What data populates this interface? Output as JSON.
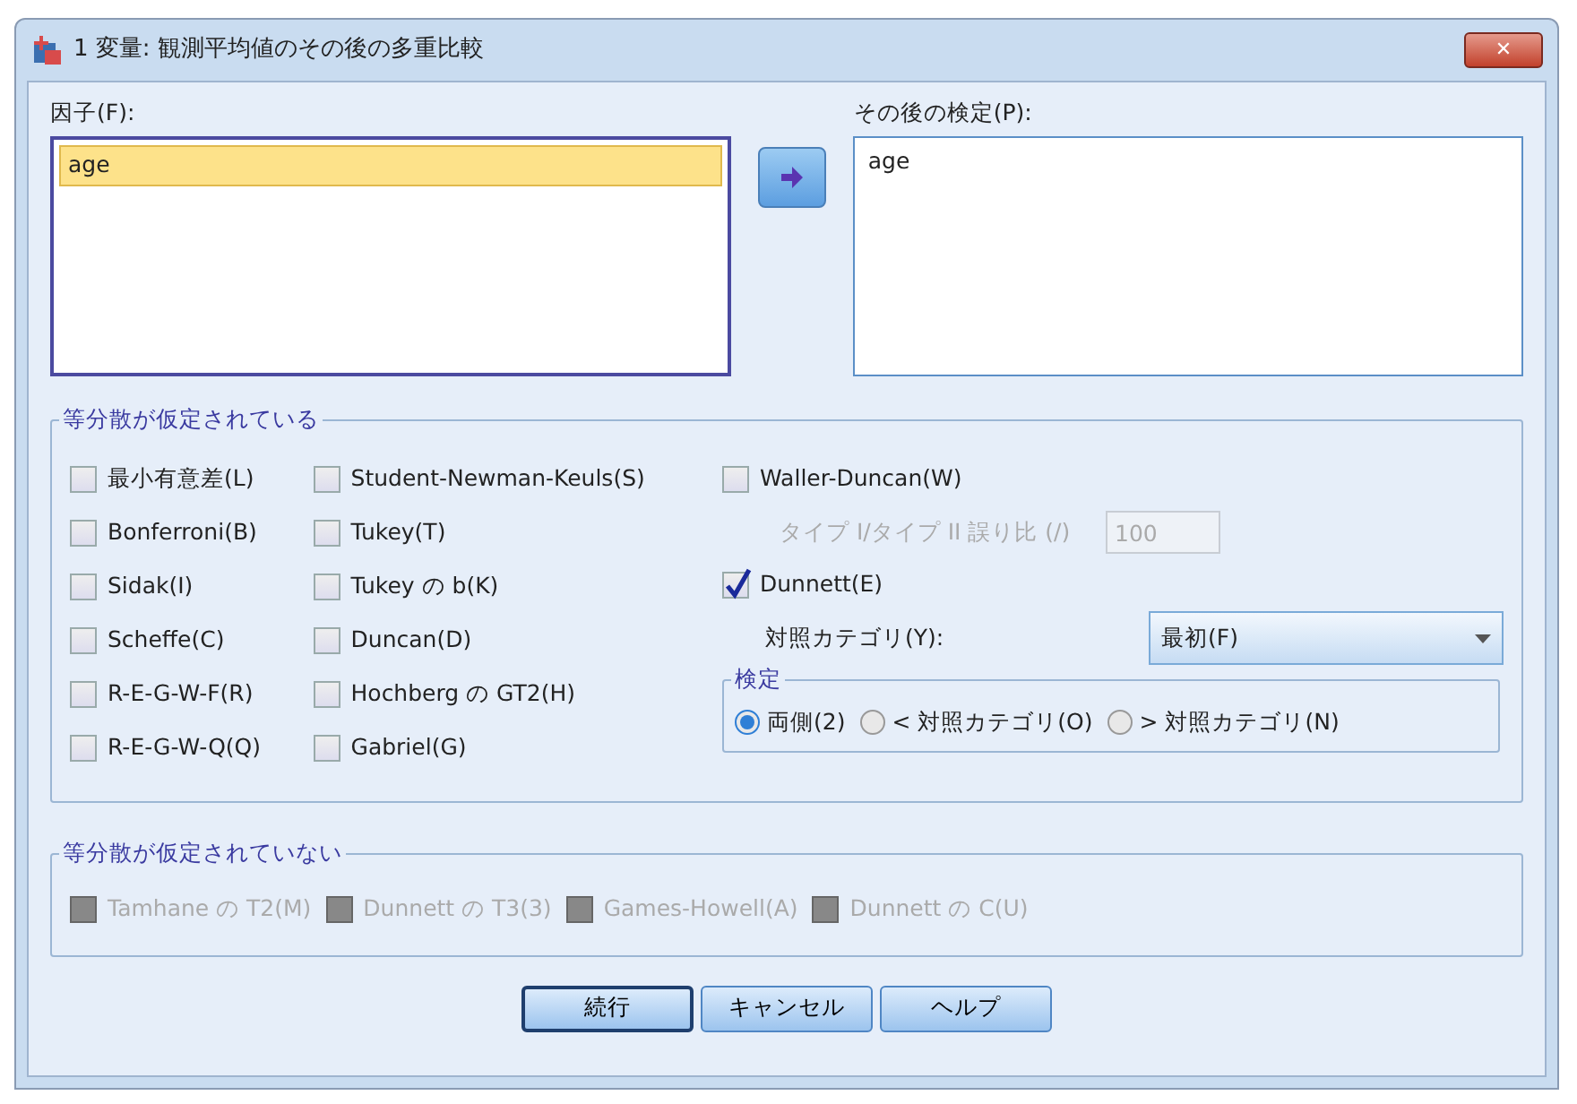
{
  "window": {
    "title": "1 変量: 観測平均値のその後の多重比較",
    "close": "✕"
  },
  "factors": {
    "label": "因子(F):",
    "items": [
      {
        "text": "age",
        "selected": true
      }
    ]
  },
  "post_hoc": {
    "label": "その後の検定(P):",
    "items": [
      {
        "text": "age",
        "selected": false
      }
    ]
  },
  "equal_variances": {
    "title": "等分散が仮定されている",
    "column_1": [
      {
        "label": "最小有意差(L)",
        "checked": false,
        "disabled": false
      },
      {
        "label": "Bonferroni(B)",
        "checked": false,
        "disabled": false
      },
      {
        "label": "Sidak(I)",
        "checked": false,
        "disabled": false
      },
      {
        "label": "Scheffe(C)",
        "checked": false,
        "disabled": false
      },
      {
        "label": "R-E-G-W-F(R)",
        "checked": false,
        "disabled": false
      },
      {
        "label": "R-E-G-W-Q(Q)",
        "checked": false,
        "disabled": false
      }
    ],
    "column_2": [
      {
        "label": "Student-Newman-Keuls(S)",
        "checked": false,
        "disabled": false
      },
      {
        "label": "Tukey(T)",
        "checked": false,
        "disabled": false
      },
      {
        "label": "Tukey の b(K)",
        "checked": false,
        "disabled": false
      },
      {
        "label": "Duncan(D)",
        "checked": false,
        "disabled": false
      },
      {
        "label": "Hochberg の GT2(H)",
        "checked": false,
        "disabled": false
      },
      {
        "label": "Gabriel(G)",
        "checked": false,
        "disabled": false
      }
    ],
    "waller_duncan": {
      "label": "Waller-Duncan(W)",
      "checked": false,
      "disabled": false
    },
    "error_ratio": {
      "label": "タイプ I/タイプ II 誤り比 (/)",
      "value": "100",
      "disabled": true
    },
    "dunnett": {
      "label": "Dunnett(E)",
      "checked": true,
      "disabled": false
    },
    "control_category": {
      "label": "対照カテゴリ(Y):",
      "value": "最初(F)"
    },
    "test": {
      "title": "検定",
      "options": [
        {
          "label": "両側(2)",
          "selected": true
        },
        {
          "label": "< 対照カテゴリ(O)",
          "selected": false
        },
        {
          "label": "> 対照カテゴリ(N)",
          "selected": false
        }
      ]
    }
  },
  "unequal_variances": {
    "title": "等分散が仮定されていない",
    "checks": [
      {
        "label": "Tamhane の T2(M)",
        "checked": false,
        "disabled": true
      },
      {
        "label": "Dunnett の T3(3)",
        "checked": false,
        "disabled": true
      },
      {
        "label": "Games-Howell(A)",
        "checked": false,
        "disabled": true
      },
      {
        "label": "Dunnett の C(U)",
        "checked": false,
        "disabled": true
      }
    ]
  },
  "buttons": [
    {
      "label": "続行",
      "default": true
    },
    {
      "label": "キャンセル",
      "default": false
    },
    {
      "label": "ヘルプ",
      "default": false
    }
  ]
}
